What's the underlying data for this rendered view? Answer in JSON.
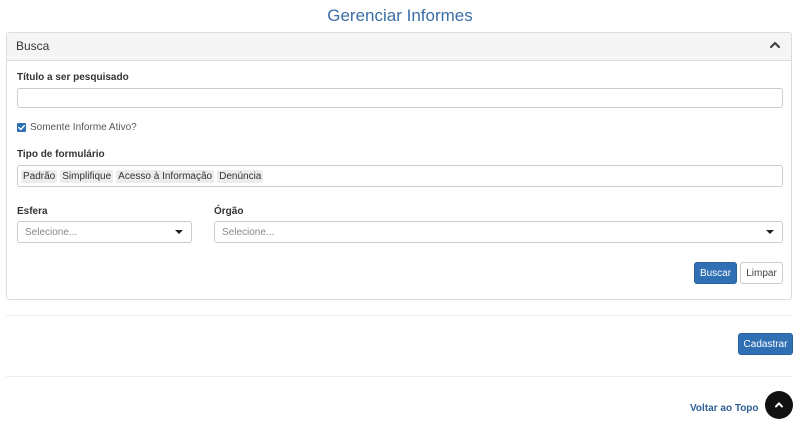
{
  "page_title": "Gerenciar Informes",
  "search_panel": {
    "heading": "Busca",
    "collapse_icon": "chevron-up-icon",
    "title_field": {
      "label": "Título a ser pesquisado",
      "value": "",
      "placeholder": ""
    },
    "active_only": {
      "label": "Somente Informe Ativo?",
      "checked": true
    },
    "form_type": {
      "label": "Tipo de formulário",
      "tags": [
        "Padrão",
        "Simplifique",
        "Acesso à Informação",
        "Denúncia"
      ]
    },
    "esfera": {
      "label": "Esfera",
      "selected": "Selecione..."
    },
    "orgao": {
      "label": "Órgão",
      "selected": "Selecione..."
    },
    "search_button": "Buscar",
    "clear_button": "Limpar"
  },
  "register_button": "Cadastrar",
  "footer": {
    "back_to_top": "Voltar ao Topo",
    "back_to_top_icon": "arrow-up-icon"
  },
  "colors": {
    "primary": "#2f6fb3",
    "title": "#3a6ea5",
    "back_to_top_bg": "#111111"
  }
}
